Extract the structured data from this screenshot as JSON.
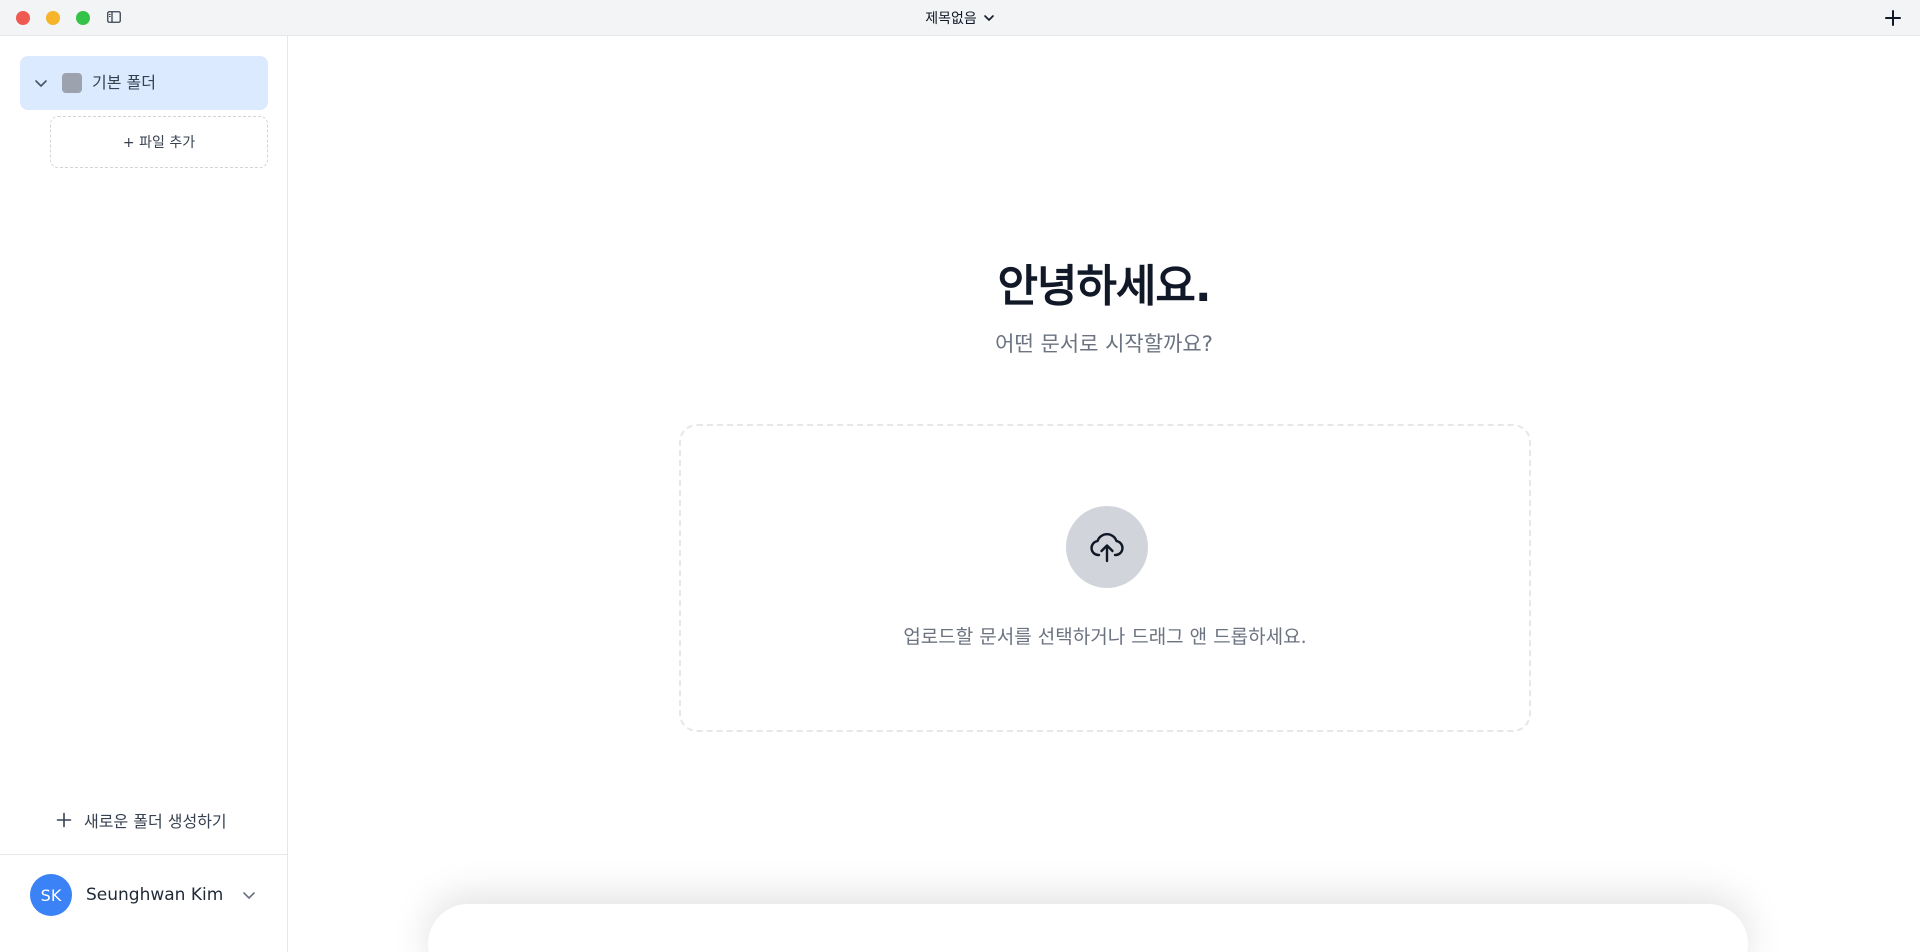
{
  "titlebar": {
    "title": "제목없음"
  },
  "sidebar": {
    "folder": {
      "label": "기본 폴더"
    },
    "add_file_label": "+ 파일 추가",
    "new_folder_label": "새로운 폴더 생성하기",
    "user": {
      "initials": "SK",
      "name": "Seunghwan Kim"
    }
  },
  "main": {
    "greeting": "안녕하세요.",
    "subgreeting": "어떤 문서로 시작할까요?",
    "dropzone_text": "업로드할 문서를 선택하거나 드래그 앤 드롭하세요."
  },
  "colors": {
    "accent": "#3b82f6",
    "selected_folder_bg": "#dbeafe"
  }
}
